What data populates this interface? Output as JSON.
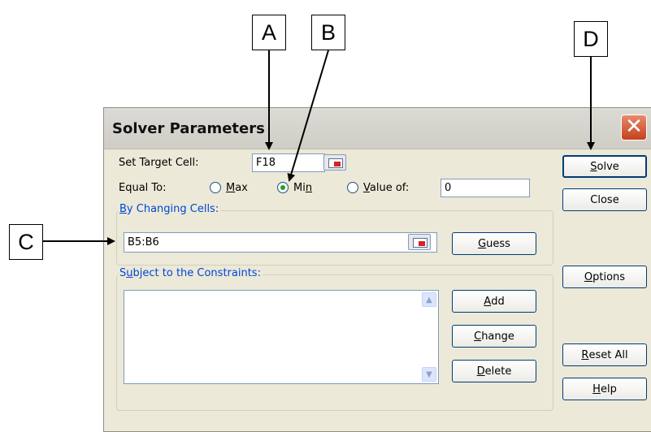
{
  "callouts": {
    "a": "A",
    "b": "B",
    "c": "C",
    "d": "D"
  },
  "dialog": {
    "title": "Solver Parameters",
    "close_symbol": "✕",
    "set_target": {
      "label": "Set Target Cell:",
      "value": "F18"
    },
    "equal_to": {
      "label": "Equal To:",
      "max_pre": "",
      "max_acc": "M",
      "max_post": "ax",
      "min_pre": "Mi",
      "min_acc": "n",
      "min_post": "",
      "value_pre": "",
      "value_acc": "V",
      "value_post": "alue of:",
      "selected": "min",
      "value_of": "0"
    },
    "changing_cells": {
      "title_pre": "",
      "title_acc": "B",
      "title_post": "y Changing Cells:",
      "value": "B5:B6"
    },
    "constraints": {
      "title_pre": "S",
      "title_acc": "u",
      "title_post": "bject to the Constraints:"
    },
    "buttons": {
      "guess": {
        "pre": "",
        "acc": "G",
        "post": "uess"
      },
      "add": {
        "pre": "",
        "acc": "A",
        "post": "dd"
      },
      "change": {
        "pre": "",
        "acc": "C",
        "post": "hange"
      },
      "delete": {
        "pre": "",
        "acc": "D",
        "post": "elete"
      },
      "solve": {
        "pre": "",
        "acc": "S",
        "post": "olve"
      },
      "close": {
        "text": "Close"
      },
      "options": {
        "pre": "",
        "acc": "O",
        "post": "ptions"
      },
      "reset_all": {
        "pre": "",
        "acc": "R",
        "post": "eset All"
      },
      "help": {
        "pre": "",
        "acc": "H",
        "post": "elp"
      }
    },
    "scroll_up": "▲",
    "scroll_down": "▼"
  },
  "colors": {
    "dialog_bg": "#ece9d8",
    "group_title": "#0046d5",
    "radio_dot": "#21a121",
    "close_button": "#d0522f"
  }
}
